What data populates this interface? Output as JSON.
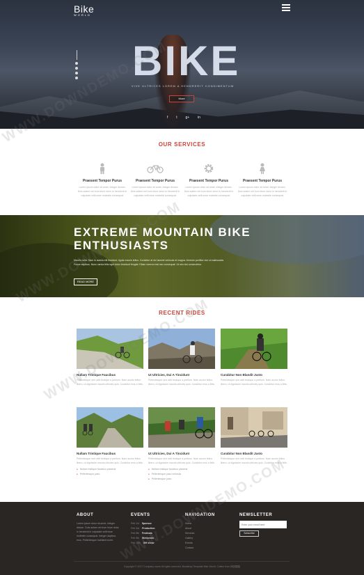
{
  "colors": {
    "accent": "#c9463d",
    "footer_bg": "#2a2624"
  },
  "header": {
    "logo_main": "Bike",
    "logo_sub": "WORLD",
    "menu_icon": "hamburger-icon"
  },
  "hero": {
    "title": "BIKE",
    "subtitle": "VIVE ULTRICES LOREM A HENDRERIT CONDIMENTUM",
    "button": "More",
    "socials": [
      "f",
      "t",
      "g+",
      "in"
    ]
  },
  "services": {
    "title": "OUR SERVICES",
    "items": [
      {
        "icon": "person-icon",
        "title": "Praesent Tempor Purus",
        "text": "Lorem ipsum dolor sit amet, integer dictum. Duis autem vel eum iriure dolor in hendrerit in vulputate velit esse molestie consequat."
      },
      {
        "icon": "bicycle-icon",
        "title": "Praesent Tempor Purus",
        "text": "Lorem ipsum dolor sit amet, integer dictum. Duis autem vel eum iriure dolor in hendrerit in vulputate velit esse molestie consequat."
      },
      {
        "icon": "gear-icon",
        "title": "Praesent Tempor Purus",
        "text": "Lorem ipsum dolor sit amet, integer dictum. Duis autem vel eum iriure dolor in hendrerit in vulputate velit esse molestie consequat."
      },
      {
        "icon": "person-icon",
        "title": "Praesent Tempor Purus",
        "text": "Lorem ipsum dolor sit amet, integer dictum. Duis autem vel eum iriure dolor in hendrerit in vulputate velit esse molestie consequat."
      }
    ]
  },
  "banner": {
    "title": "EXTREME MOUNTAIN BIKE ENTHUSIASTS",
    "text": "Mauris nulla. Nam in lacinia elit tincidunt, ligula mauris tellus. Curabitur at dui laoreet vehicula et magna. Aenean porttitor nisl ut malesuada. Fusce dapibus. Nunc varius felis eget dolor tincidunt feugiat. Etiam viverra erat nec consequat. Ut nec nisi consectetur.",
    "button": "READ MORE"
  },
  "rides": {
    "title": "RECENT RIDES",
    "items": [
      {
        "title": "Nullam Tristique Faucibus",
        "text": "Pellentesque sed velit tristique a pretium. Nam auctor tellus libero, ut dignissim mauris ultricies quis. Curabitur eros a felis.",
        "bullets": []
      },
      {
        "title": "Ut Ultricies, Dui A Tincidunt",
        "text": "Pellentesque sed velit tristique a pretium. Nam auctor tellus libero, ut dignissim mauris ultricies quis. Curabitur eros a felis.",
        "bullets": []
      },
      {
        "title": "Curabitur Non Blandit Justo",
        "text": "Pellentesque sed velit tristique a pretium. Nam auctor tellus libero, ut dignissim mauris ultricies quis. Curabitur eros a felis.",
        "bullets": []
      },
      {
        "title": "Nullam Tristique Faucibus",
        "text": "Pellentesque sed velit tristique a pretium. Nam auctor tellus libero, ut dignissim mauris ultricies quis. Curabitur eros a felis.",
        "bullets": [
          "Nullam tristique faucibus placerat",
          "Pellentesque justo"
        ]
      },
      {
        "title": "Ut Ultricies, Dui A Tincidunt",
        "text": "Pellentesque sed velit tristique a pretium. Nam auctor tellus libero, ut dignissim mauris ultricies quis. Curabitur eros a felis.",
        "bullets": [
          "Nullam tristique faucibus placerat",
          "Pellentesque justo vehicula",
          "Pellentesque justo"
        ]
      },
      {
        "title": "Curabitur Non Blandit Justo",
        "text": "Pellentesque sed velit tristique a pretium. Nam auctor tellus libero, ut dignissim mauris ultricies quis. Curabitur eros a felis.",
        "bullets": []
      }
    ]
  },
  "footer": {
    "about_title": "ABOUT",
    "about_text": "Lorem ipsum dolor sit amet, integer dictum. Duis autem vel eum iriure dolor in hendrerit in vulputate velit esse molestie consequat. Integer dapibus eros. Pellentesque habitant morbi.",
    "events_title": "EVENTS",
    "events": [
      {
        "date": "Feb 1st",
        "name": "Sponsor"
      },
      {
        "date": "Feb 3rd",
        "name": "Production"
      },
      {
        "date": "Feb 5th",
        "name": "Festivals"
      },
      {
        "date": "Feb 9th",
        "name": "Weekends"
      },
      {
        "date": "Feb 11th",
        "name": "Gift show"
      }
    ],
    "nav_title": "NAVIGATION",
    "nav": [
      "Home",
      "About",
      "Services",
      "Gallery",
      "Events",
      "Contact"
    ],
    "newsletter_title": "NEWSLETTER",
    "newsletter_placeholder": "Enter your email here",
    "newsletter_button": "Subscribe",
    "copyright": "Copyright © 2017 Company name All rights reserved. Bootstrap Template Bike World. Collect from 网页模板"
  },
  "watermark": "WWW.DOWNDEMO.COM"
}
